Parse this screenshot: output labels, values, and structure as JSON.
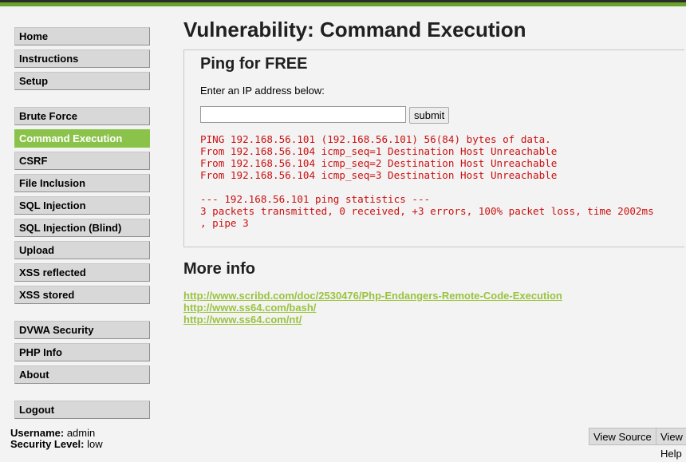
{
  "colors": {
    "accent": "#8bc34a",
    "error_text": "#cc1010",
    "link": "#9ac33d"
  },
  "menu": {
    "groups": [
      [
        "Home",
        "Instructions",
        "Setup"
      ],
      [
        "Brute Force",
        "Command Execution",
        "CSRF",
        "File Inclusion",
        "SQL Injection",
        "SQL Injection (Blind)",
        "Upload",
        "XSS reflected",
        "XSS stored"
      ],
      [
        "DVWA Security",
        "PHP Info",
        "About"
      ],
      [
        "Logout"
      ]
    ],
    "selected": "Command Execution"
  },
  "page": {
    "title": "Vulnerability: Command Execution",
    "form_title": "Ping for FREE",
    "prompt": "Enter an IP address below:",
    "ip_value": "",
    "submit_label": "submit",
    "output": "PING 192.168.56.101 (192.168.56.101) 56(84) bytes of data.\nFrom 192.168.56.104 icmp_seq=1 Destination Host Unreachable\nFrom 192.168.56.104 icmp_seq=2 Destination Host Unreachable\nFrom 192.168.56.104 icmp_seq=3 Destination Host Unreachable\n\n--- 192.168.56.101 ping statistics ---\n3 packets transmitted, 0 received, +3 errors, 100% packet loss, time 2002ms\n, pipe 3",
    "more_info_title": "More info",
    "links": [
      "http://www.scribd.com/doc/2530476/Php-Endangers-Remote-Code-Execution",
      "http://www.ss64.com/bash/",
      "http://www.ss64.com/nt/"
    ]
  },
  "footer": {
    "username_label": "Username:",
    "username": "admin",
    "security_label": "Security Level:",
    "security": "low",
    "view_source": "View Source",
    "view_help": "View Help"
  }
}
